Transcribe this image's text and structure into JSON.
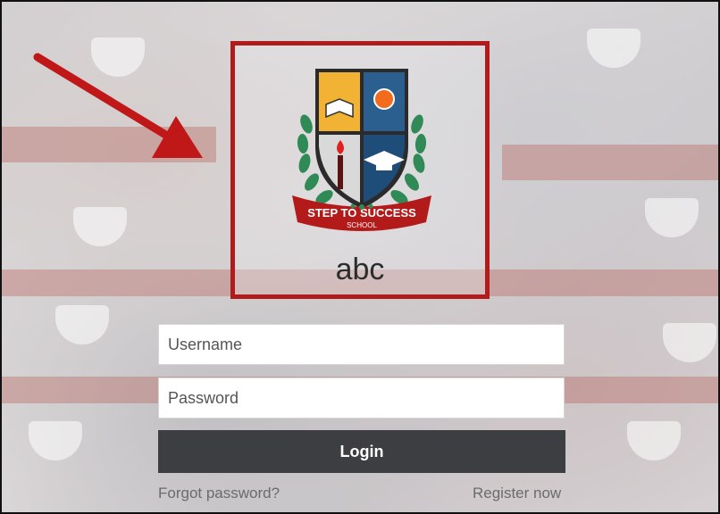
{
  "logo": {
    "banner_text": "STEP TO SUCCESS",
    "sub_text": "SCHOOL",
    "school_name": "abc"
  },
  "form": {
    "username_placeholder": "Username",
    "password_placeholder": "Password",
    "login_label": "Login",
    "forgot_label": "Forgot password?",
    "register_label": "Register now"
  },
  "colors": {
    "highlight_border": "#b01c1c",
    "arrow": "#c01818",
    "button_bg": "#3d3e42"
  }
}
